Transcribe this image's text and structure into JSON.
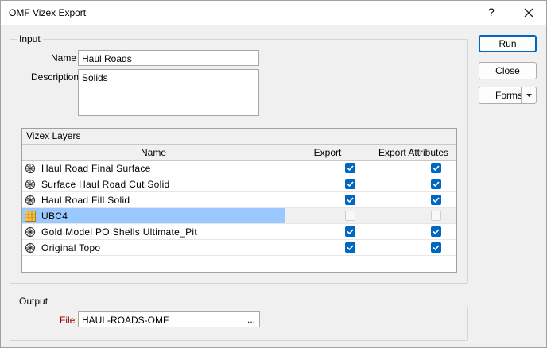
{
  "window": {
    "title": "OMF Vizex Export",
    "help": "?"
  },
  "input": {
    "legend": "Input",
    "name_label": "Name",
    "name_value": "Haul Roads",
    "description_label": "Description",
    "description_value": "Solids"
  },
  "layers": {
    "caption": "Vizex Layers",
    "columns": [
      "Name",
      "Export",
      "Export Attributes"
    ],
    "rows": [
      {
        "name": "Haul Road Final Surface",
        "icon": "surface-icon",
        "export": true,
        "attributes": true
      },
      {
        "name": "Surface Haul Road Cut Solid",
        "icon": "surface-icon",
        "export": true,
        "attributes": true
      },
      {
        "name": "Haul Road Fill Solid",
        "icon": "surface-icon",
        "export": true,
        "attributes": true
      },
      {
        "name": "UBC4",
        "icon": "block-model-icon",
        "export": false,
        "attributes": false,
        "selected": true
      },
      {
        "name": "Gold Model PO Shells Ultimate_Pit",
        "icon": "surface-icon",
        "export": true,
        "attributes": true
      },
      {
        "name": "Original Topo",
        "icon": "surface-icon",
        "export": true,
        "attributes": true
      }
    ]
  },
  "output": {
    "legend": "Output",
    "file_label": "File",
    "file_value": "HAUL-ROADS-OMF",
    "browse": "..."
  },
  "buttons": {
    "run": "Run",
    "close": "Close",
    "forms": "Forms"
  },
  "colors": {
    "accent": "#0067c0",
    "selection": "#99c9ff",
    "file_label": "#a00000"
  }
}
